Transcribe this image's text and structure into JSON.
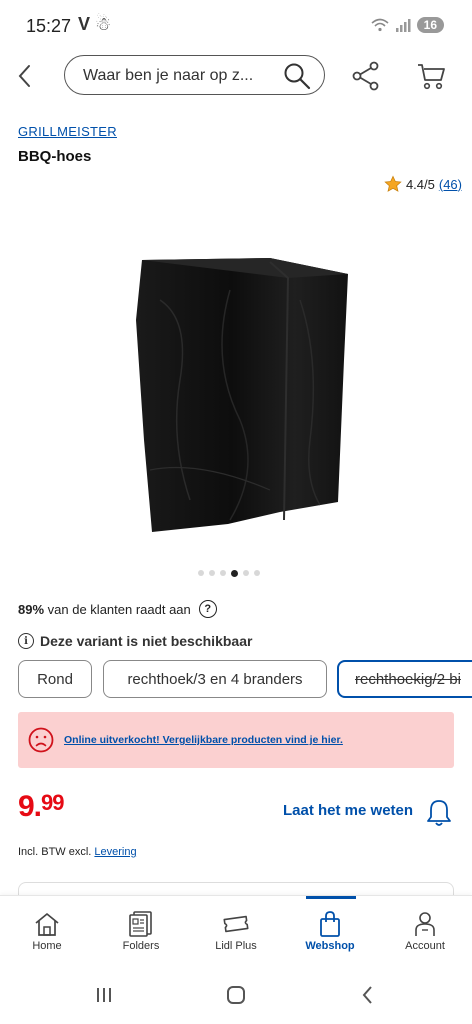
{
  "status_bar": {
    "time": "15:27",
    "left_icons": "V ☃",
    "battery": "16"
  },
  "header": {
    "search_placeholder": "Waar ben je naar op z..."
  },
  "product": {
    "brand": "GRILLMEISTER",
    "title": "BBQ-hoes",
    "rating": "4.4/5",
    "rating_count": "(46)",
    "carousel_total": 6,
    "carousel_active": 3,
    "recommend_percent": "89%",
    "recommend_text": "van de klanten raadt aan",
    "variant_note": "Deze variant is niet beschikbaar",
    "variants": [
      {
        "label": "Rond"
      },
      {
        "label": "rechthoek/3 en 4 branders"
      },
      {
        "label": "rechthoekig/2 bi"
      }
    ],
    "alert": "Online uitverkocht! Vergelijkbare producten vind je hier.",
    "price_main": "9.",
    "price_cents": "99",
    "notify_label": "Laat het me weten",
    "vat_text": "Incl. BTW excl.",
    "vat_link": "Levering"
  },
  "colors": {
    "accent": "#0050aa",
    "price": "#e60a14",
    "alert_bg": "#fbd0d0"
  },
  "bottom_nav": {
    "items": [
      {
        "label": "Home",
        "icon": "home-icon"
      },
      {
        "label": "Folders",
        "icon": "folders-icon"
      },
      {
        "label": "Lidl Plus",
        "icon": "ticket-icon"
      },
      {
        "label": "Webshop",
        "icon": "shopping-bag-icon",
        "active": true
      },
      {
        "label": "Account",
        "icon": "account-icon"
      }
    ]
  }
}
